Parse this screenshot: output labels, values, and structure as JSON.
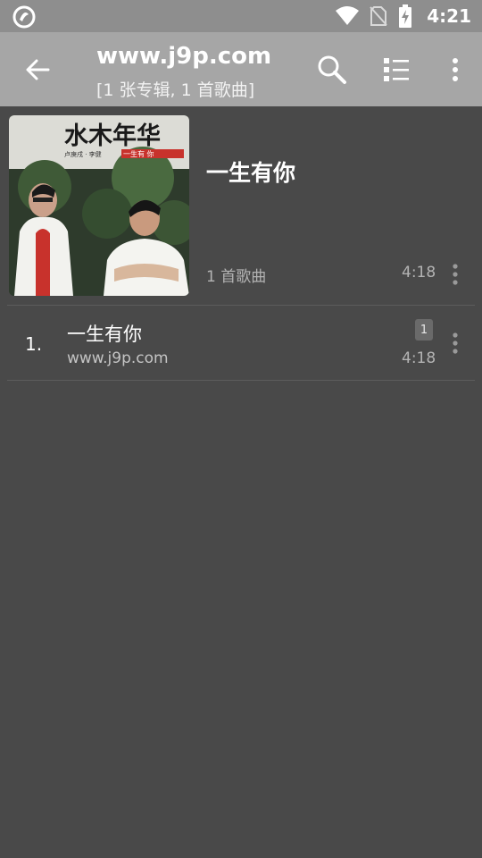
{
  "status_bar": {
    "time": "4:21"
  },
  "app_bar": {
    "title": "www.j9p.com",
    "subtitle": "[1 张专辑, 1 首歌曲]",
    "back_icon": "arrow-left-icon",
    "search_icon": "search-icon",
    "view_icon": "list-view-icon",
    "more_icon": "more-vert-icon"
  },
  "album": {
    "cover_title": "水木年华",
    "cover_artists": "卢庚戌 · 李健",
    "cover_subtitle": "一生有  你",
    "title": "一生有你",
    "song_count": "1 首歌曲",
    "duration": "4:18"
  },
  "tracks": [
    {
      "number": "1.",
      "title": "一生有你",
      "artist": "www.j9p.com",
      "badge": "1",
      "duration": "4:18"
    }
  ],
  "colors": {
    "background": "#494949",
    "app_bar": "#a6a6a6",
    "status_bar": "#8e8e8e"
  }
}
